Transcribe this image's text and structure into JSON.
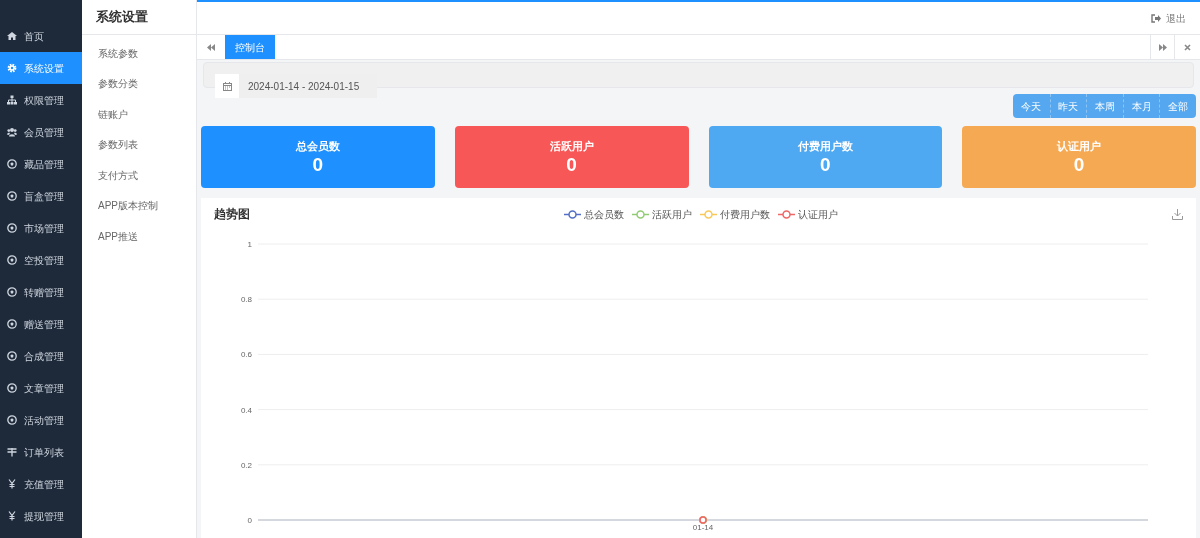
{
  "sidebar": {
    "items": [
      {
        "label": "首页",
        "kind": "home",
        "selected": false
      },
      {
        "label": "系统设置",
        "kind": "gear",
        "selected": true
      },
      {
        "label": "权限管理",
        "kind": "sitemap",
        "selected": false
      },
      {
        "label": "会员管理",
        "kind": "users",
        "selected": false
      },
      {
        "label": "藏品管理",
        "kind": "ball",
        "selected": false
      },
      {
        "label": "盲盒管理",
        "kind": "ball",
        "selected": false
      },
      {
        "label": "市场管理",
        "kind": "ball",
        "selected": false
      },
      {
        "label": "空投管理",
        "kind": "ball",
        "selected": false
      },
      {
        "label": "转赠管理",
        "kind": "ball",
        "selected": false
      },
      {
        "label": "赠送管理",
        "kind": "ball",
        "selected": false
      },
      {
        "label": "合成管理",
        "kind": "ball",
        "selected": false
      },
      {
        "label": "文章管理",
        "kind": "ball",
        "selected": false
      },
      {
        "label": "活动管理",
        "kind": "ball",
        "selected": false
      },
      {
        "label": "订单列表",
        "kind": "list",
        "selected": false
      },
      {
        "label": "充值管理",
        "kind": "yen",
        "selected": false
      },
      {
        "label": "提现管理",
        "kind": "yen",
        "selected": false
      }
    ]
  },
  "submenu": {
    "title": "系统设置",
    "items": [
      "系统参数",
      "参数分类",
      "链账户",
      "参数列表",
      "支付方式",
      "APP版本控制",
      "APP推送"
    ]
  },
  "top_bar": {
    "logout": "退出"
  },
  "tabs": [
    {
      "label": "控制台",
      "selected": true
    }
  ],
  "date_range": {
    "value": "2024-01-14 - 2024-01-15"
  },
  "range_buttons": [
    "今天",
    "昨天",
    "本周",
    "本月",
    "全部"
  ],
  "stat_cards": [
    {
      "label": "总会员数",
      "value": "0",
      "color": "#1e90ff"
    },
    {
      "label": "活跃用户",
      "value": "0",
      "color": "#f75757"
    },
    {
      "label": "付费用户数",
      "value": "0",
      "color": "#4ea8f2"
    },
    {
      "label": "认证用户",
      "value": "0",
      "color": "#f6a953"
    }
  ],
  "trend": {
    "title": "趋势图",
    "chart_data": {
      "type": "line",
      "categories": [
        "01-14"
      ],
      "series": [
        {
          "name": "总会员数",
          "color": "#5470c6",
          "marker": "circle",
          "values": [
            0
          ]
        },
        {
          "name": "活跃用户",
          "color": "#91cc75",
          "marker": "circle",
          "values": [
            0
          ]
        },
        {
          "name": "付费用户数",
          "color": "#fac858",
          "marker": "circle",
          "values": [
            0
          ]
        },
        {
          "name": "认证用户",
          "color": "#ee6666",
          "marker": "circle",
          "values": [
            0
          ]
        }
      ],
      "grid": true,
      "ylim": [
        0,
        1
      ],
      "yticks": [
        0,
        0.2,
        0.4,
        0.6,
        0.8,
        1
      ]
    }
  }
}
